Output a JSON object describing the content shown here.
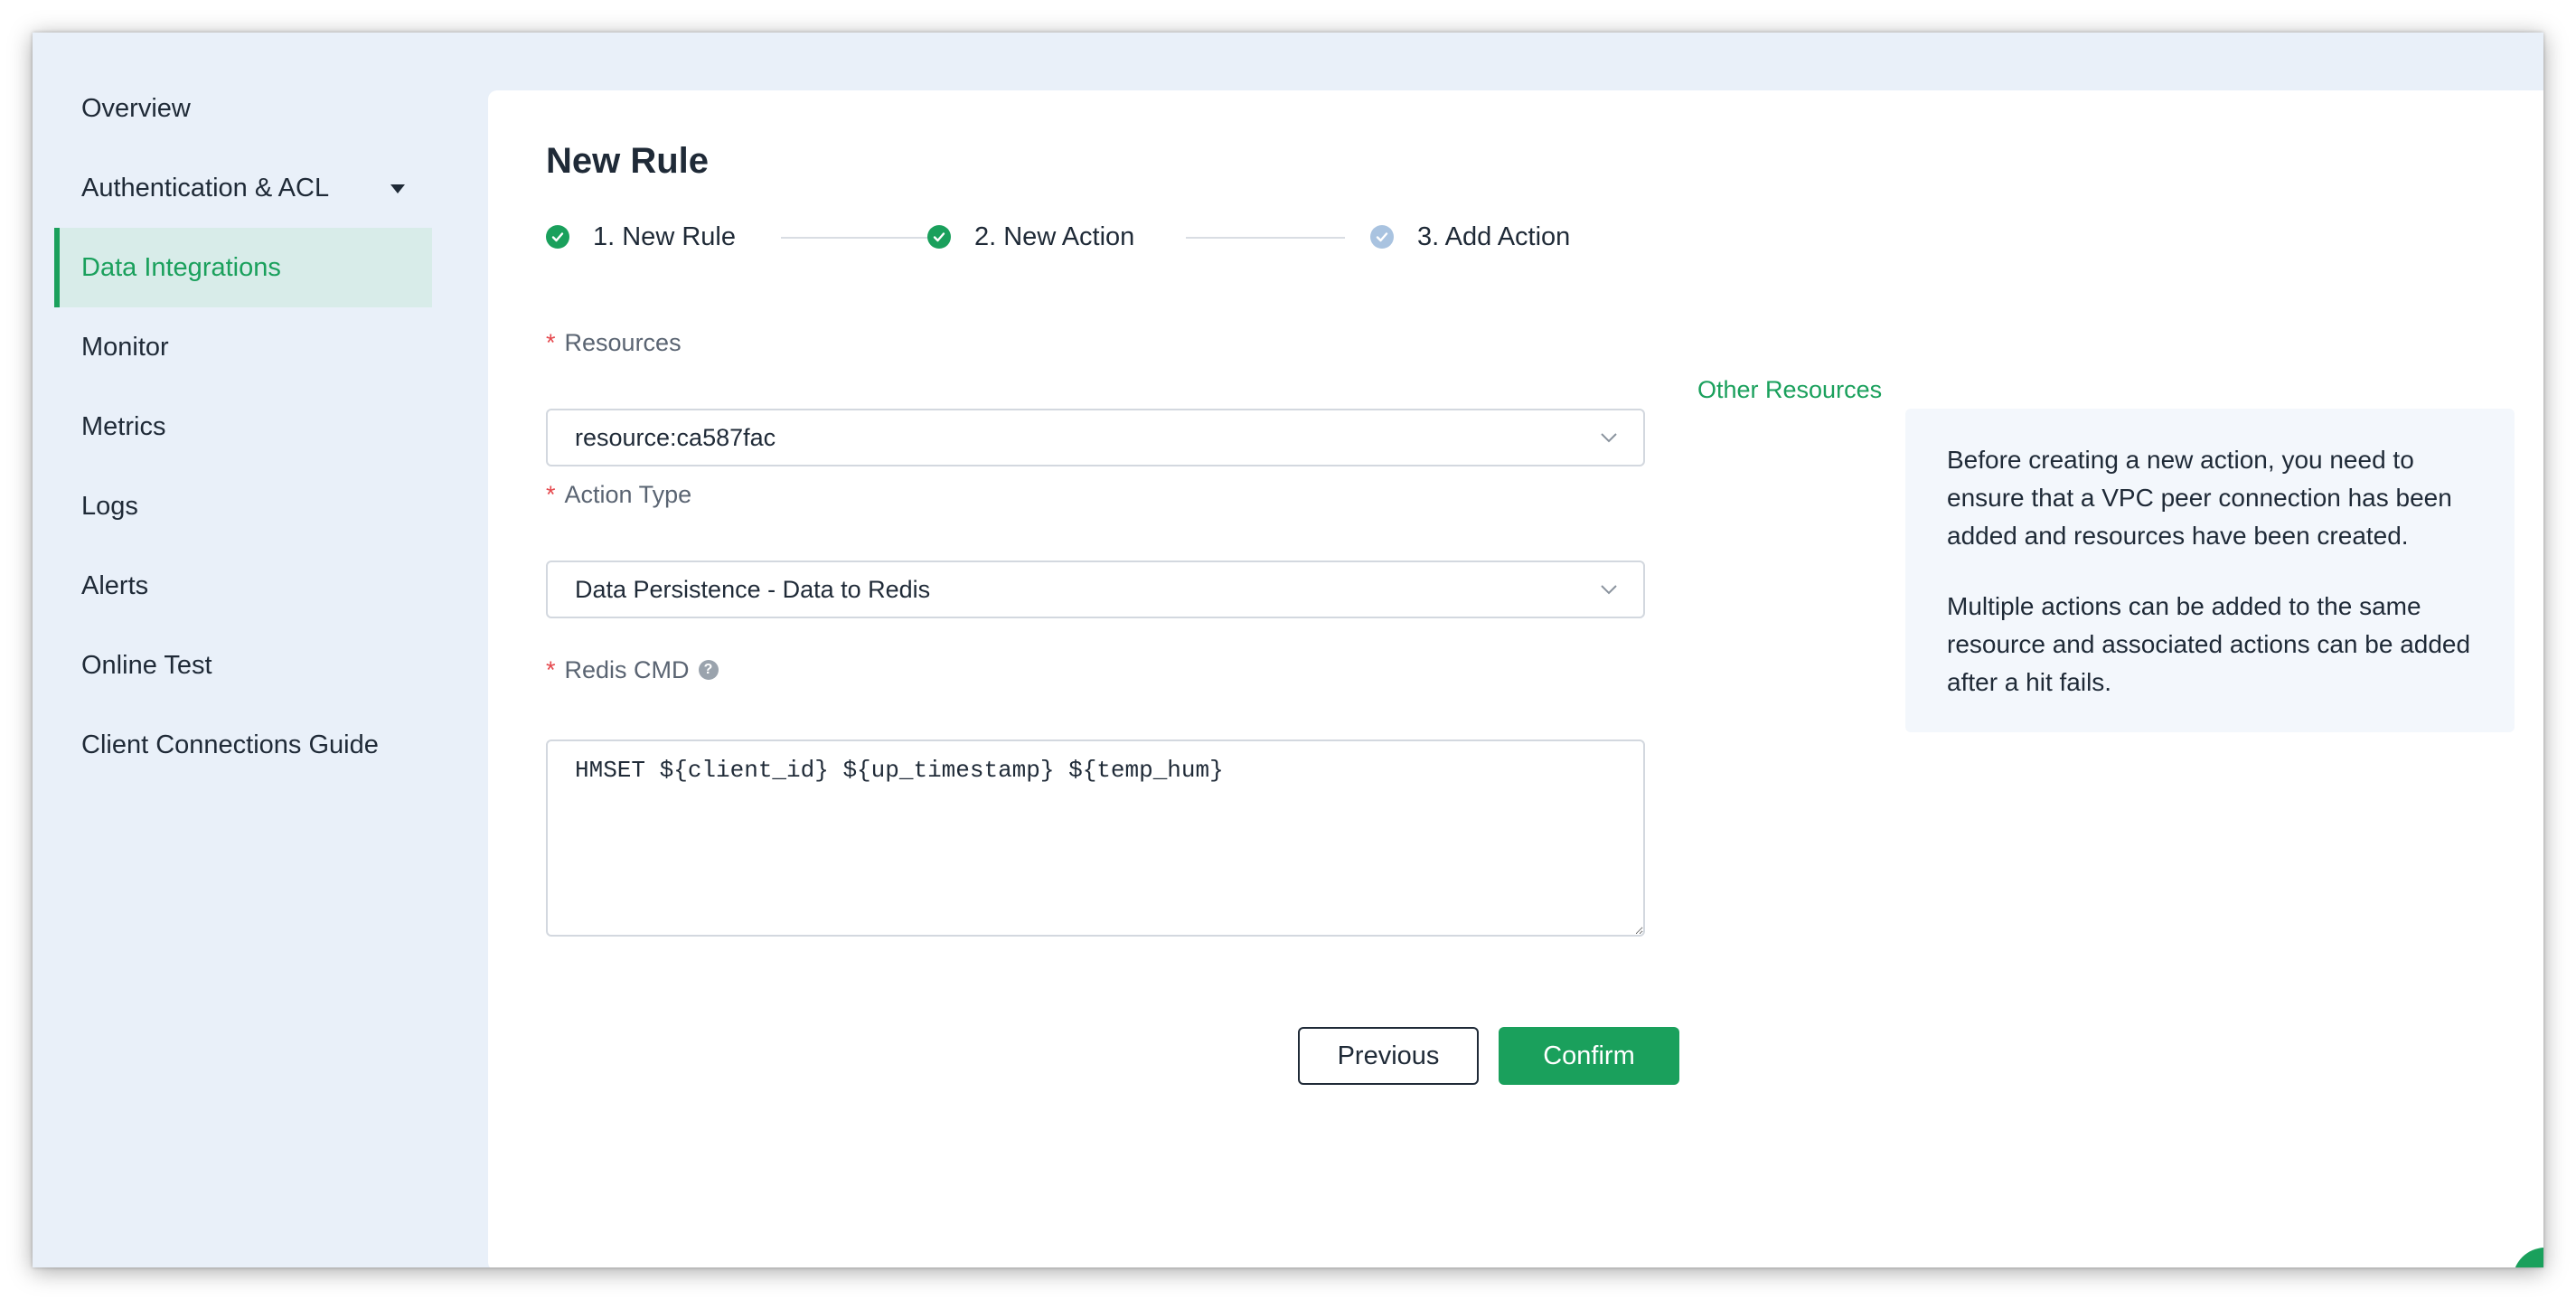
{
  "sidebar": {
    "items": [
      {
        "label": "Overview"
      },
      {
        "label": "Authentication & ACL"
      },
      {
        "label": "Data Integrations"
      },
      {
        "label": "Monitor"
      },
      {
        "label": "Metrics"
      },
      {
        "label": "Logs"
      },
      {
        "label": "Alerts"
      },
      {
        "label": "Online Test"
      },
      {
        "label": "Client Connections Guide"
      }
    ],
    "active_index": 2
  },
  "main": {
    "title": "New Rule",
    "steps": [
      {
        "label": "1. New Rule",
        "status": "done"
      },
      {
        "label": "2. New Action",
        "status": "done"
      },
      {
        "label": "3. Add Action",
        "status": "current"
      }
    ],
    "form": {
      "resources_label": "Resources",
      "resources_value": "resource:ca587fac",
      "other_resources_link": "Other Resources",
      "action_type_label": "Action Type",
      "action_type_value": "Data Persistence - Data to Redis",
      "redis_cmd_label": "Redis CMD",
      "redis_cmd_value": "HMSET ${client_id} ${up_timestamp} ${temp_hum}",
      "required_marker": "*"
    },
    "buttons": {
      "previous": "Previous",
      "confirm": "Confirm"
    },
    "info": {
      "paragraph1": "Before creating a new action, you need to ensure that a VPC peer connection has been added and resources have been created.",
      "paragraph2": "Multiple actions can be added to the same resource and associated actions can be added after a hit fails."
    }
  },
  "colors": {
    "accent": "#1aa05c",
    "sidebar_bg": "#e9f0f9",
    "active_item_bg": "#d8ece9",
    "required": "#e5484d",
    "step_pending": "#a9c3e0"
  },
  "icons": {
    "step_done": "check-circle-icon",
    "step_current": "check-circle-icon",
    "dropdown": "chevron-down-icon",
    "help": "question-circle-icon",
    "nav_expand": "caret-down-icon",
    "floating": "hand-pointer-icon"
  }
}
